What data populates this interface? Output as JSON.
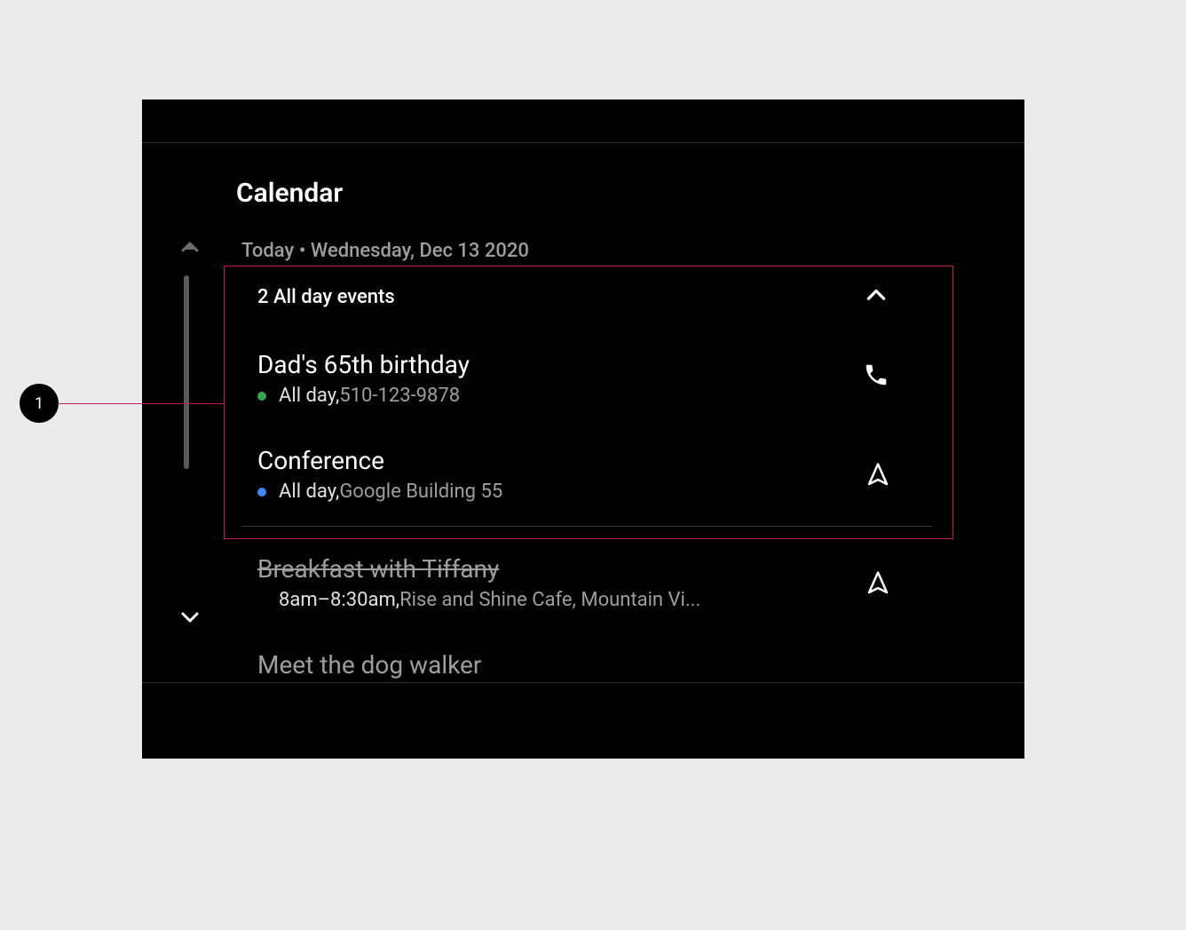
{
  "annotation": {
    "label": "1"
  },
  "app": {
    "title": "Calendar",
    "date_line": "Today • Wednesday, Dec 13 2020"
  },
  "section": {
    "header": "2 All day events"
  },
  "events": [
    {
      "title": "Dad's 65th birthday",
      "time": "All day, ",
      "detail": "510-123-9878",
      "dot_color": "#34a853",
      "action": "phone"
    },
    {
      "title": "Conference",
      "time": "All day, ",
      "detail": "Google Building 55",
      "dot_color": "#4285f4",
      "action": "navigate"
    },
    {
      "title": "Breakfast with Tiffany",
      "time": "8am–8:30am, ",
      "detail": "Rise and Shine Cafe, Mountain Vi...",
      "dot_color": "#34a853",
      "action": "navigate",
      "past": true
    },
    {
      "title": "Meet the dog walker",
      "time": "",
      "detail": "",
      "dim": true
    }
  ]
}
